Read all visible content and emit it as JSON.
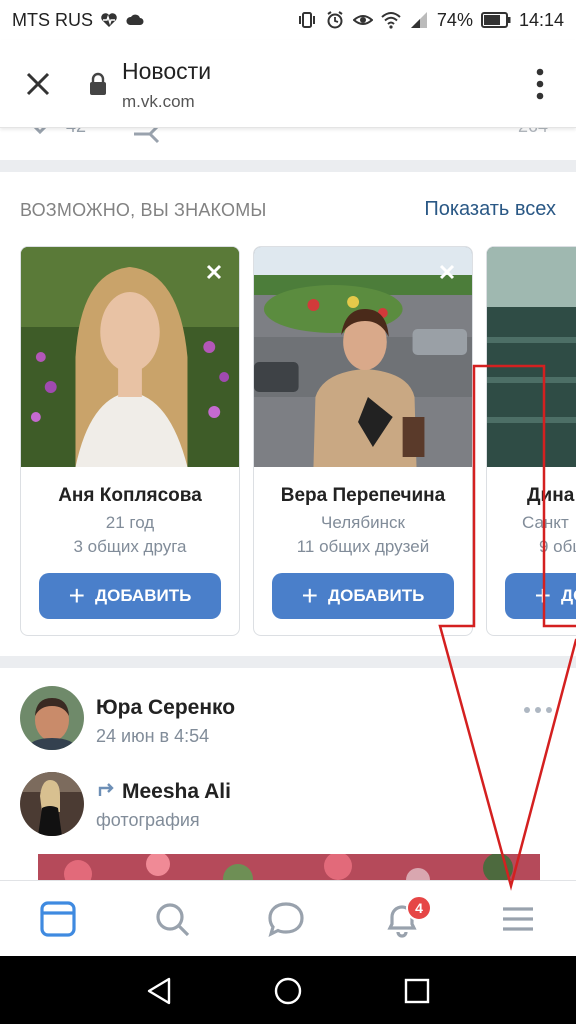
{
  "status_bar": {
    "carrier": "MTS RUS",
    "battery": "74%",
    "time": "14:14"
  },
  "browser": {
    "title": "Новости",
    "domain": "m.vk.com"
  },
  "previous_post": {
    "likes": "42",
    "views": "264"
  },
  "friends_block": {
    "heading": "ВОЗМОЖНО, ВЫ ЗНАКОМЫ",
    "show_all": "Показать всех",
    "cards": [
      {
        "name": "Аня Коплясова",
        "line1": "21 год",
        "line2": "3 общих друга",
        "button": "ДОБАВИТЬ"
      },
      {
        "name": "Вера Перепечина",
        "line1": "Челябинск",
        "line2": "11 общих друзей",
        "button": "ДОБАВИТЬ"
      },
      {
        "name": "Дина",
        "line1": "Санкт",
        "line2": "9 общ",
        "button": "ДОБАВИТЬ"
      }
    ]
  },
  "post": {
    "author": "Юра Серенко",
    "date": "24 июн в 4:54",
    "shared_from": "Meesha Ali",
    "shared_type": "фотография"
  },
  "tab_bar": {
    "items": [
      "news-icon",
      "search-icon",
      "messages-icon",
      "notifications-icon",
      "menu-icon"
    ],
    "notifications_badge": "4"
  },
  "colors": {
    "accent": "#2a5885",
    "button": "#4a7fca",
    "badge": "#e64646",
    "annotation": "#d42020"
  }
}
